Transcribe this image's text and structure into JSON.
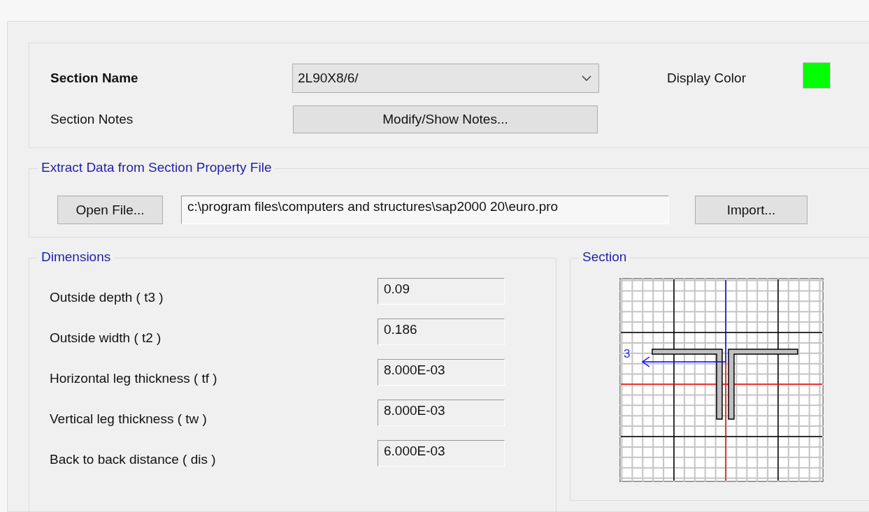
{
  "section_name": {
    "label": "Section Name",
    "value": "2L90X8/6/"
  },
  "display_color": {
    "label": "Display Color",
    "color": "#00ff00"
  },
  "section_notes": {
    "label": "Section Notes",
    "button": "Modify/Show Notes..."
  },
  "extract_data": {
    "title": "Extract Data from Section Property File",
    "open_button": "Open File...",
    "file_path": "c:\\program files\\computers and structures\\sap2000 20\\euro.pro",
    "import_button": "Import..."
  },
  "dimensions": {
    "title": "Dimensions",
    "fields": [
      {
        "label": "Outside depth  ( t3 )",
        "value": "0.09"
      },
      {
        "label": "Outside width  ( t2 )",
        "value": "0.186"
      },
      {
        "label": "Horizontal leg thickness  ( tf )",
        "value": "8.000E-03"
      },
      {
        "label": "Vertical leg thickness  ( tw )",
        "value": "8.000E-03"
      },
      {
        "label": "Back to back distance  ( dis )",
        "value": "6.000E-03"
      }
    ]
  },
  "section_preview": {
    "title": "Section",
    "axis_label": "3"
  }
}
